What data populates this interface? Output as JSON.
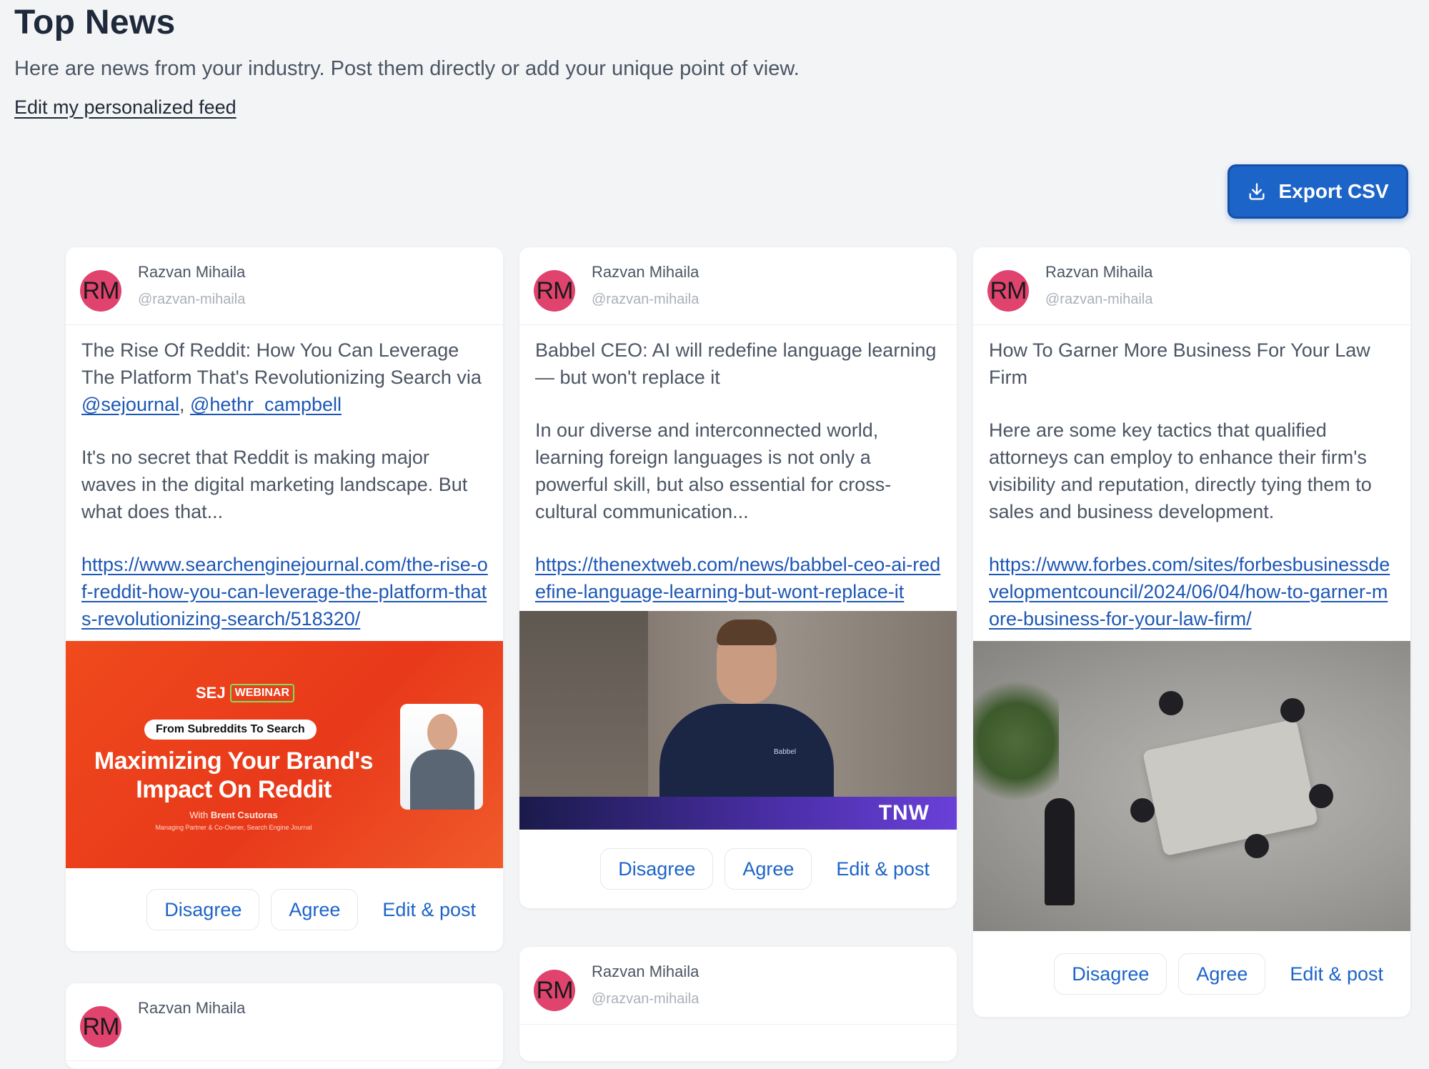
{
  "header": {
    "title": "Top News",
    "subtitle": "Here are news from your industry. Post them directly or add your unique point of view.",
    "edit_feed_label": "Edit my personalized feed"
  },
  "toolbar": {
    "export_label": "Export CSV",
    "export_icon": "download-icon"
  },
  "author": {
    "initials": "RM",
    "name": "Razvan Mihaila",
    "handle": "@razvan-mihaila",
    "avatar_color": "#e0436e"
  },
  "actions": {
    "disagree": "Disagree",
    "agree": "Agree",
    "edit_post": "Edit & post"
  },
  "cards": [
    {
      "headline": "The Rise Of Reddit: How You Can Leverage The Platform That's Revolutionizing Search via ",
      "mention_1": "@sejournal",
      "mention_sep": ", ",
      "mention_2": "@hethr_campbell",
      "summary": "It's no secret that Reddit is making major waves in the digital marketing landscape. But what does that...",
      "url": "https://www.searchenginejournal.com/the-rise-of-reddit-how-you-can-leverage-the-platform-thats-revolutionizing-search/518320/",
      "image": {
        "brand": "SEJ",
        "badge": "WEBINAR",
        "tag": "From Subreddits To Search",
        "title_line1": "Maximizing Your Brand's",
        "title_line2": "Impact On Reddit",
        "presenter_prefix": "With ",
        "presenter": "Brent Csutoras",
        "presenter_role": "Managing Partner & Co-Owner, Search Engine Journal"
      }
    },
    {
      "headline": "Babbel CEO: AI will redefine language learning — but won't replace it",
      "summary": "In our diverse and interconnected world, learning foreign languages is not only a powerful skill, but also essential for cross-cultural communication...",
      "url": "https://thenextweb.com/news/babbel-ceo-ai-redefine-language-learning-but-wont-replace-it",
      "image": {
        "logo": "TNW",
        "shirt_logo": "Babbel"
      }
    },
    {
      "headline": "How To Garner More Business For Your Law Firm",
      "summary": "Here are some key tactics that qualified attorneys can employ to enhance their firm's visibility and reputation, directly tying them to sales and business development.",
      "url": "https://www.forbes.com/sites/forbesbusinessdevelopmentcouncil/2024/06/04/how-to-garner-more-business-for-your-law-firm/"
    },
    {},
    {}
  ]
}
